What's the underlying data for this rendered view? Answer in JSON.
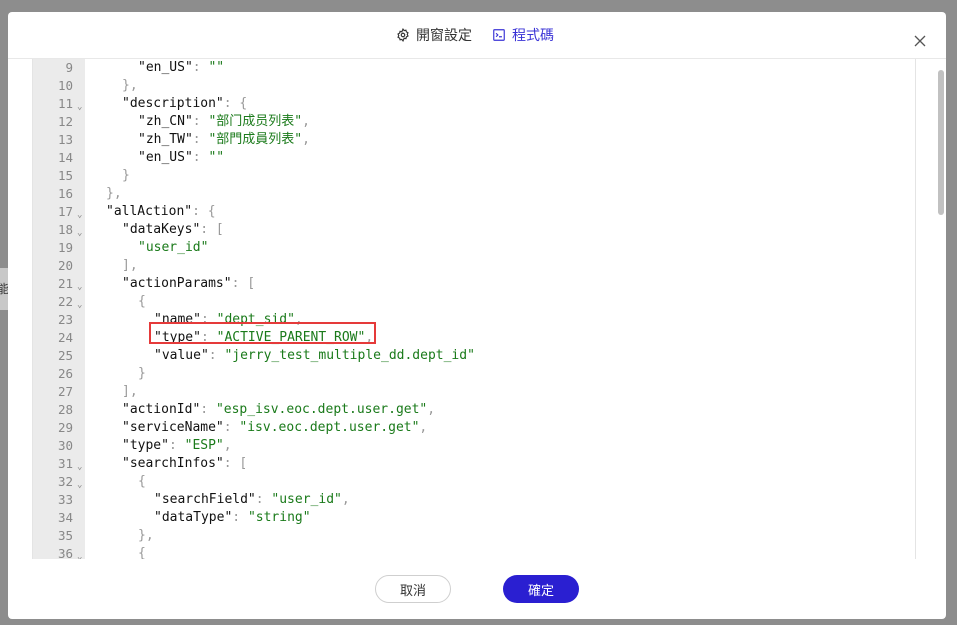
{
  "header": {
    "tab_settings_label": "開窗設定",
    "tab_code_label": "程式碼",
    "active_tab": "程式碼"
  },
  "colors": {
    "accent": "#2a1fd1",
    "string": "#1a7a1a",
    "highlight_box": "#e53a3a"
  },
  "editor": {
    "lines": [
      {
        "n": "9",
        "fold": false,
        "segs": [
          [
            "k",
            "\"en_US\""
          ],
          [
            "p",
            ": "
          ],
          [
            "s",
            "\"\""
          ]
        ],
        "indent": 3
      },
      {
        "n": "10",
        "fold": false,
        "segs": [
          [
            "p",
            "},"
          ]
        ],
        "indent": 2
      },
      {
        "n": "11",
        "fold": true,
        "segs": [
          [
            "k",
            "\"description\""
          ],
          [
            "p",
            ": {"
          ]
        ],
        "indent": 2
      },
      {
        "n": "12",
        "fold": false,
        "segs": [
          [
            "k",
            "\"zh_CN\""
          ],
          [
            "p",
            ": "
          ],
          [
            "s",
            "\"部门成员列表\""
          ],
          [
            "p",
            ","
          ]
        ],
        "indent": 3
      },
      {
        "n": "13",
        "fold": false,
        "segs": [
          [
            "k",
            "\"zh_TW\""
          ],
          [
            "p",
            ": "
          ],
          [
            "s",
            "\"部門成員列表\""
          ],
          [
            "p",
            ","
          ]
        ],
        "indent": 3
      },
      {
        "n": "14",
        "fold": false,
        "segs": [
          [
            "k",
            "\"en_US\""
          ],
          [
            "p",
            ": "
          ],
          [
            "s",
            "\"\""
          ]
        ],
        "indent": 3
      },
      {
        "n": "15",
        "fold": false,
        "segs": [
          [
            "p",
            "}"
          ]
        ],
        "indent": 2
      },
      {
        "n": "16",
        "fold": false,
        "segs": [
          [
            "p",
            "},"
          ]
        ],
        "indent": 1
      },
      {
        "n": "17",
        "fold": true,
        "segs": [
          [
            "k",
            "\"allAction\""
          ],
          [
            "p",
            ": {"
          ]
        ],
        "indent": 1
      },
      {
        "n": "18",
        "fold": true,
        "segs": [
          [
            "k",
            "\"dataKeys\""
          ],
          [
            "p",
            ": ["
          ]
        ],
        "indent": 2
      },
      {
        "n": "19",
        "fold": false,
        "segs": [
          [
            "s",
            "\"user_id\""
          ]
        ],
        "indent": 3
      },
      {
        "n": "20",
        "fold": false,
        "segs": [
          [
            "p",
            "],"
          ]
        ],
        "indent": 2
      },
      {
        "n": "21",
        "fold": true,
        "segs": [
          [
            "k",
            "\"actionParams\""
          ],
          [
            "p",
            ": ["
          ]
        ],
        "indent": 2
      },
      {
        "n": "22",
        "fold": true,
        "segs": [
          [
            "p",
            "{"
          ]
        ],
        "indent": 3
      },
      {
        "n": "23",
        "fold": false,
        "segs": [
          [
            "k",
            "\"name\""
          ],
          [
            "p",
            ": "
          ],
          [
            "s",
            "\"dept_sid\""
          ],
          [
            "p",
            ","
          ]
        ],
        "indent": 4
      },
      {
        "n": "24",
        "fold": false,
        "segs": [
          [
            "k",
            "\"type\""
          ],
          [
            "p",
            ": "
          ],
          [
            "s",
            "\"ACTIVE_PARENT_ROW\""
          ],
          [
            "p",
            ","
          ]
        ],
        "indent": 4
      },
      {
        "n": "25",
        "fold": false,
        "segs": [
          [
            "k",
            "\"value\""
          ],
          [
            "p",
            ": "
          ],
          [
            "s",
            "\"jerry_test_multiple_dd.dept_id\""
          ]
        ],
        "indent": 4
      },
      {
        "n": "26",
        "fold": false,
        "segs": [
          [
            "p",
            "}"
          ]
        ],
        "indent": 3
      },
      {
        "n": "27",
        "fold": false,
        "segs": [
          [
            "p",
            "],"
          ]
        ],
        "indent": 2
      },
      {
        "n": "28",
        "fold": false,
        "segs": [
          [
            "k",
            "\"actionId\""
          ],
          [
            "p",
            ": "
          ],
          [
            "s",
            "\"esp_isv.eoc.dept.user.get\""
          ],
          [
            "p",
            ","
          ]
        ],
        "indent": 2
      },
      {
        "n": "29",
        "fold": false,
        "segs": [
          [
            "k",
            "\"serviceName\""
          ],
          [
            "p",
            ": "
          ],
          [
            "s",
            "\"isv.eoc.dept.user.get\""
          ],
          [
            "p",
            ","
          ]
        ],
        "indent": 2
      },
      {
        "n": "30",
        "fold": false,
        "segs": [
          [
            "k",
            "\"type\""
          ],
          [
            "p",
            ": "
          ],
          [
            "s",
            "\"ESP\""
          ],
          [
            "p",
            ","
          ]
        ],
        "indent": 2
      },
      {
        "n": "31",
        "fold": true,
        "segs": [
          [
            "k",
            "\"searchInfos\""
          ],
          [
            "p",
            ": ["
          ]
        ],
        "indent": 2
      },
      {
        "n": "32",
        "fold": true,
        "segs": [
          [
            "p",
            "{"
          ]
        ],
        "indent": 3
      },
      {
        "n": "33",
        "fold": false,
        "segs": [
          [
            "k",
            "\"searchField\""
          ],
          [
            "p",
            ": "
          ],
          [
            "s",
            "\"user_id\""
          ],
          [
            "p",
            ","
          ]
        ],
        "indent": 4
      },
      {
        "n": "34",
        "fold": false,
        "segs": [
          [
            "k",
            "\"dataType\""
          ],
          [
            "p",
            ": "
          ],
          [
            "s",
            "\"string\""
          ]
        ],
        "indent": 4
      },
      {
        "n": "35",
        "fold": false,
        "segs": [
          [
            "p",
            "},"
          ]
        ],
        "indent": 3
      },
      {
        "n": "36",
        "fold": true,
        "segs": [
          [
            "p",
            "{"
          ]
        ],
        "indent": 3
      }
    ]
  },
  "footer": {
    "cancel_label": "取消",
    "ok_label": "確定"
  },
  "backdrop_fragment": "能"
}
